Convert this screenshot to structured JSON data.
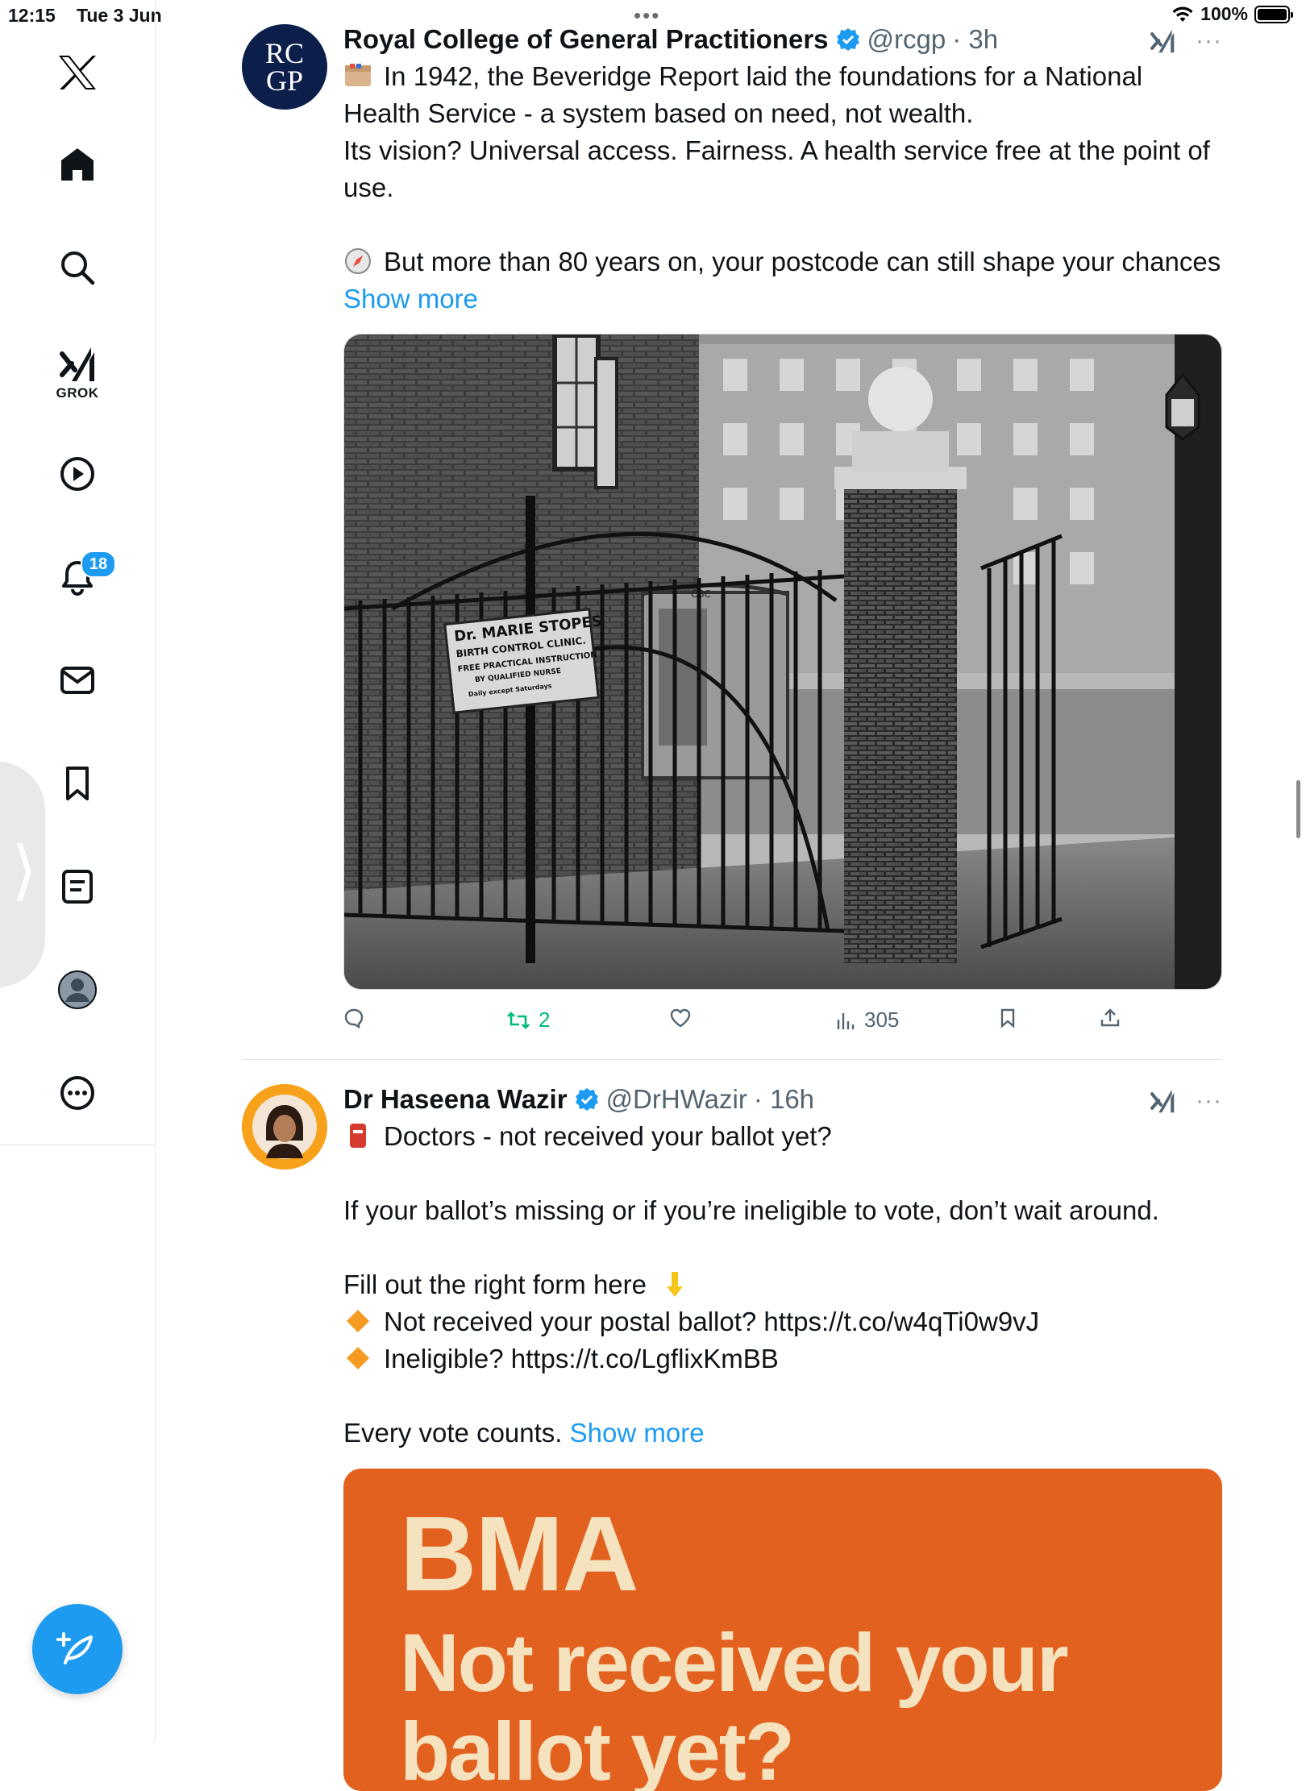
{
  "status_bar": {
    "time": "12:15",
    "date": "Tue 3 Jun",
    "battery": "100%",
    "dots": "•••"
  },
  "sidebar": {
    "items": [
      {
        "name": "x-logo-icon"
      },
      {
        "name": "home-icon"
      },
      {
        "name": "search-icon"
      },
      {
        "name": "grok-icon",
        "label": "GROK"
      },
      {
        "name": "video-icon"
      },
      {
        "name": "notifications-icon",
        "badge": "18"
      },
      {
        "name": "messages-icon"
      },
      {
        "name": "bookmarks-icon"
      },
      {
        "name": "lists-icon"
      },
      {
        "name": "profile-icon"
      },
      {
        "name": "more-icon"
      }
    ]
  },
  "colors": {
    "accent": "#1d9bf0",
    "repost_green": "#00ba7c",
    "bma_orange": "#e2611f",
    "bma_text": "#f5e3c0",
    "rcgp_navy": "#0c1f4a"
  },
  "tweets": [
    {
      "avatar_lines": [
        "RC",
        "GP"
      ],
      "name": "Royal College of General Practitioners",
      "handle": "@rcgp",
      "time": "· 3h",
      "body": [
        "In 1942, the Beveridge Report laid the foundations for a National Health Service - a system based on need, not wealth.",
        "Its vision? Universal access. Fairness. A health service free at the point of use.",
        "",
        "But more than 80 years on, your postcode can still shape your chances"
      ],
      "show_more": "Show more",
      "image": {
        "sign_lines": [
          "Dr. MARIE STOPES",
          "BIRTH CONTROL CLINIC.",
          "FREE PRACTICAL INSTRUCTION",
          "BY QUALIFIED NURSE",
          "Daily except Saturdays"
        ],
        "caravan_label": "CBC"
      },
      "actions": {
        "replies": "",
        "reposts": "2",
        "likes": "",
        "views": "305"
      }
    },
    {
      "name": "Dr Haseena Wazir",
      "handle": "@DrHWazir",
      "time": "· 16h",
      "body": [
        "Doctors - not received your ballot yet?",
        "",
        "If your ballot’s missing or if you’re ineligible to vote, don’t wait around.",
        "",
        "Fill out the right form here",
        "Not received your postal ballot? https://t.co/w4qTi0w9vJ",
        "Ineligible? https://t.co/LgflixKmBB",
        "",
        "Every vote counts."
      ],
      "show_more": "Show more",
      "card": {
        "title": "BMA",
        "headline": "Not received your",
        "headline2": "ballot yet?"
      }
    }
  ]
}
